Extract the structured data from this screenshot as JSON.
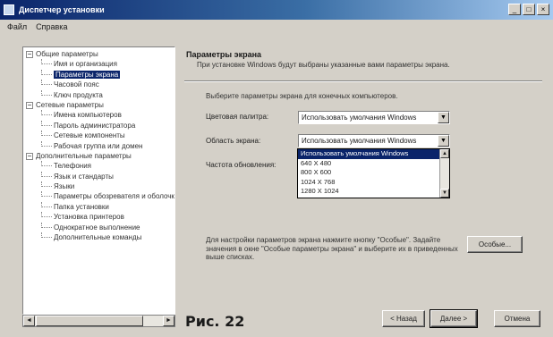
{
  "window": {
    "title": "Диспетчер установки"
  },
  "menu": [
    "Файл",
    "Справка"
  ],
  "controls": {
    "minimize": "_",
    "maximize": "□",
    "close": "×"
  },
  "tree": [
    {
      "label": "Общие параметры",
      "level": 0,
      "expander": "−"
    },
    {
      "label": "Имя и организация",
      "level": 1
    },
    {
      "label": "Параметры экрана",
      "level": 1,
      "selected": true
    },
    {
      "label": "Часовой пояс",
      "level": 1
    },
    {
      "label": "Ключ продукта",
      "level": 1
    },
    {
      "label": "Сетевые параметры",
      "level": 0,
      "expander": "−"
    },
    {
      "label": "Имена компьютеров",
      "level": 1
    },
    {
      "label": "Пароль администратора",
      "level": 1
    },
    {
      "label": "Сетевые компоненты",
      "level": 1
    },
    {
      "label": "Рабочая группа или домен",
      "level": 1
    },
    {
      "label": "Дополнительные параметры",
      "level": 0,
      "expander": "−"
    },
    {
      "label": "Телефония",
      "level": 1
    },
    {
      "label": "Язык и стандарты",
      "level": 1
    },
    {
      "label": "Языки",
      "level": 1
    },
    {
      "label": "Параметры обозревателя и оболочки",
      "level": 1
    },
    {
      "label": "Папка установки",
      "level": 1
    },
    {
      "label": "Установка принтеров",
      "level": 1
    },
    {
      "label": "Однократное выполнение",
      "level": 1
    },
    {
      "label": "Дополнительные команды",
      "level": 1
    }
  ],
  "scroll": {
    "left": "◄",
    "right": "►"
  },
  "caption": "Рис. 22",
  "section": {
    "title": "Параметры экрана",
    "description": "При установке Windows будут выбраны указанные вами параметры экрана.",
    "instruction": "Выберите параметры экрана для конечных компьютеров."
  },
  "fields": {
    "color_palette": {
      "label": "Цветовая палитра:",
      "value": "Использовать умолчания Windows"
    },
    "screen_area": {
      "label": "Область экрана:",
      "value": "Использовать умолчания Windows"
    },
    "refresh_rate": {
      "label": "Частота обновления:"
    }
  },
  "dropdown_arrow": "▼",
  "dropdown_options": [
    "Использовать умолчания Windows",
    "640 X 480",
    "800 X 600",
    "1024 X 768",
    "1280 X 1024"
  ],
  "dd_scroll": {
    "up": "▲",
    "down": "▼"
  },
  "custom": {
    "text": "Для настройки параметров экрана нажмите кнопку \"Особые\". Задайте значения в окне \"Особые параметры экрана\" и выберите их в приведенных выше списках.",
    "button": "Особые..."
  },
  "nav": {
    "back": "< Назад",
    "next": "Далее >",
    "cancel": "Отмена"
  }
}
